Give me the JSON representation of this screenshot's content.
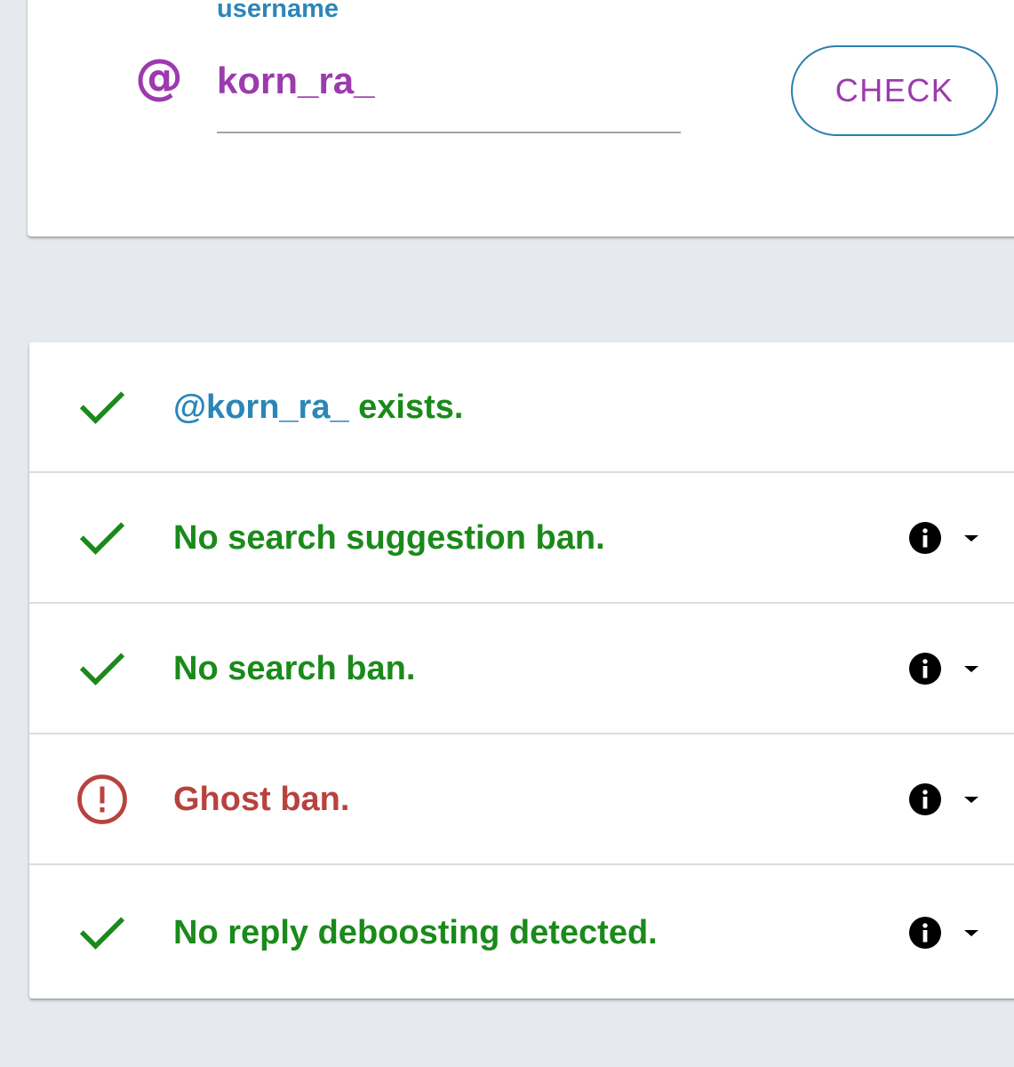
{
  "search": {
    "label": "username",
    "at_icon_glyph": "@",
    "at_icon": "at-sign-icon",
    "value": "korn_ra_",
    "button_label": "CHECK"
  },
  "results": {
    "exists": {
      "handle": "@korn_ra_",
      "text": " exists.",
      "status": "ok",
      "icon": "checkmark-icon"
    },
    "search_suggestion_ban": {
      "text": "No search suggestion ban.",
      "status": "ok",
      "icon": "checkmark-icon"
    },
    "search_ban": {
      "text": "No search ban.",
      "status": "ok",
      "icon": "checkmark-icon"
    },
    "ghost_ban": {
      "text": "Ghost ban.",
      "status": "warning",
      "icon": "warning-circle-icon"
    },
    "reply_deboosting": {
      "text": "No reply deboosting detected.",
      "status": "ok",
      "icon": "checkmark-icon"
    }
  },
  "colors": {
    "accent_purple": "#9c3aae",
    "accent_blue": "#2b86b8",
    "ok_green": "#1a8a1a",
    "warning_red": "#b8423e",
    "background": "#e6eaee"
  }
}
